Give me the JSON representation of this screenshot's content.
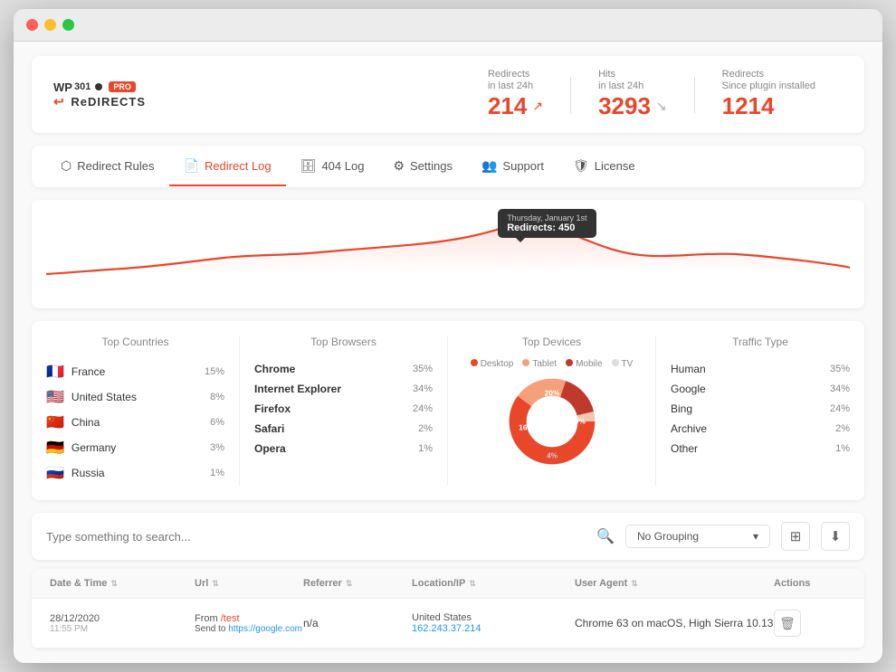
{
  "window": {
    "title": "WP 301 Redirects PRO"
  },
  "header": {
    "logo": {
      "wp": "WP",
      "num": "301",
      "pro": "PRO",
      "brand": "ReDIRECTS"
    },
    "stats": [
      {
        "label": "Redirects",
        "sublabel": "in last 24h",
        "value": "214",
        "arrow": "↗",
        "arrow_type": "up"
      },
      {
        "label": "Hits",
        "sublabel": "in last 24h",
        "value": "3293",
        "arrow": "↘",
        "arrow_type": "down"
      },
      {
        "label": "Redirects",
        "sublabel": "Since plugin installed",
        "value": "1214",
        "arrow": "",
        "arrow_type": ""
      }
    ]
  },
  "nav": {
    "tabs": [
      {
        "id": "redirect-rules",
        "label": "Redirect Rules",
        "icon": "⬡",
        "active": false
      },
      {
        "id": "redirect-log",
        "label": "Redirect Log",
        "icon": "📄",
        "active": true
      },
      {
        "id": "404-log",
        "label": "404 Log",
        "icon": "🗄",
        "active": false
      },
      {
        "id": "settings",
        "label": "Settings",
        "icon": "⚙",
        "active": false
      },
      {
        "id": "support",
        "label": "Support",
        "icon": "👥",
        "active": false
      },
      {
        "id": "license",
        "label": "License",
        "icon": "🛡",
        "active": false
      }
    ]
  },
  "chart": {
    "tooltip": {
      "date": "Thursday, January 1st",
      "label": "Redirects:",
      "value": "450"
    }
  },
  "analytics": {
    "countries": {
      "title": "Top Countries",
      "items": [
        {
          "flag": "🇫🇷",
          "name": "France",
          "value": "15%"
        },
        {
          "flag": "🇺🇸",
          "name": "United States",
          "value": "8%"
        },
        {
          "flag": "🇨🇳",
          "name": "China",
          "value": "6%"
        },
        {
          "flag": "🇩🇪",
          "name": "Germany",
          "value": "3%"
        },
        {
          "flag": "🇷🇺",
          "name": "Russia",
          "value": "1%"
        }
      ]
    },
    "browsers": {
      "title": "Top Browsers",
      "items": [
        {
          "name": "Chrome",
          "value": "35%"
        },
        {
          "name": "Internet Explorer",
          "value": "34%"
        },
        {
          "name": "Firefox",
          "value": "24%"
        },
        {
          "name": "Safari",
          "value": "2%"
        },
        {
          "name": "Opera",
          "value": "1%"
        }
      ]
    },
    "devices": {
      "title": "Top Devices",
      "legend": [
        {
          "label": "Desktop",
          "color": "#e8472a"
        },
        {
          "label": "Tablet",
          "color": "#ff8c69"
        },
        {
          "label": "Mobile",
          "color": "#e8472a"
        },
        {
          "label": "TV",
          "color": "#ddd"
        }
      ],
      "segments": [
        {
          "label": "60%",
          "value": 60,
          "color": "#e8472a",
          "offset": 0
        },
        {
          "label": "20%",
          "value": 20,
          "color": "#f4a07a",
          "offset": 60
        },
        {
          "label": "16%",
          "value": 16,
          "color": "#c0392b",
          "offset": 80
        },
        {
          "label": "4%",
          "value": 4,
          "color": "#f8c9b0",
          "offset": 96
        }
      ]
    },
    "traffic": {
      "title": "Traffic Type",
      "items": [
        {
          "name": "Human",
          "value": "35%"
        },
        {
          "name": "Google",
          "value": "34%"
        },
        {
          "name": "Bing",
          "value": "24%"
        },
        {
          "name": "Archive",
          "value": "2%"
        },
        {
          "name": "Other",
          "value": "1%"
        }
      ]
    }
  },
  "filter": {
    "search_placeholder": "Type something to search...",
    "grouping_label": "No Grouping"
  },
  "table": {
    "columns": [
      {
        "label": "Date & Time",
        "sortable": true
      },
      {
        "label": "Url",
        "sortable": true
      },
      {
        "label": "Referrer",
        "sortable": true
      },
      {
        "label": "Location/IP",
        "sortable": true
      },
      {
        "label": "User Agent",
        "sortable": true
      },
      {
        "label": "Actions",
        "sortable": false
      }
    ],
    "rows": [
      {
        "date": "28/12/2020",
        "time": "11:55 PM",
        "from_label": "From",
        "from_path": "/test",
        "send_label": "Send to",
        "send_url": "https://google.com",
        "referrer": "n/a",
        "country": "United States",
        "ip": "162.243.37.214",
        "user_agent": "Chrome 63 on macOS, High Sierra 10.13"
      }
    ]
  }
}
